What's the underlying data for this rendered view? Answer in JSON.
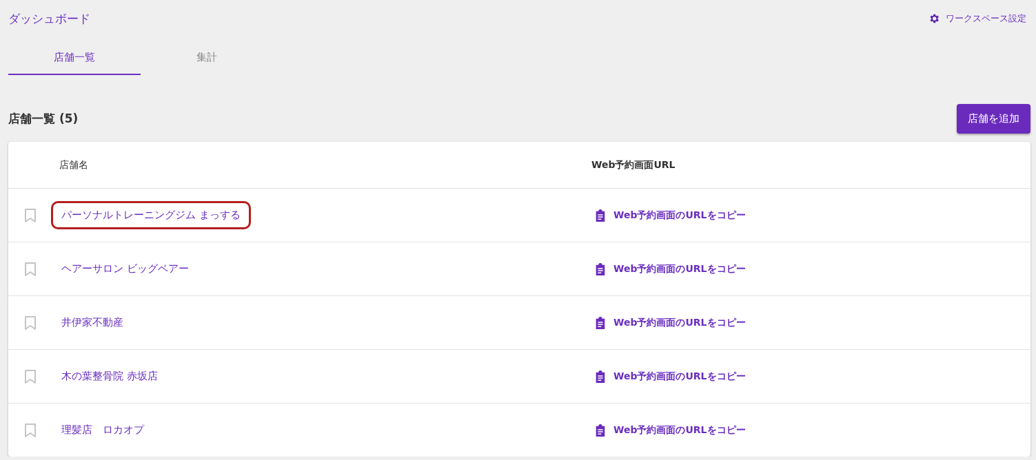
{
  "header": {
    "title": "ダッシュボード",
    "settings_link": "ワークスペース設定"
  },
  "tabs": [
    {
      "label": "店舗一覧",
      "selected": true
    },
    {
      "label": "集計",
      "selected": false
    }
  ],
  "section": {
    "title": "店舗一覧 (5)",
    "add_button": "店舗を追加"
  },
  "table": {
    "columns": [
      "店舗名",
      "Web予約画面URL"
    ],
    "rows": [
      {
        "name": "パーソナルトレーニングジム まっする",
        "bookmarked": false,
        "highlighted": true,
        "link": "Web予約画面のURLをコピー"
      },
      {
        "name": "ヘアーサロン ビッグベアー",
        "bookmarked": false,
        "highlighted": false,
        "link": "Web予約画面のURLをコピー"
      },
      {
        "name": "井伊家不動産",
        "bookmarked": false,
        "highlighted": false,
        "link": "Web予約画面のURLをコピー"
      },
      {
        "name": "木の葉整骨院 赤坂店",
        "bookmarked": false,
        "highlighted": false,
        "link": "Web予約画面のURLをコピー"
      },
      {
        "name": "理髪店　ロカオプ",
        "bookmarked": false,
        "highlighted": false,
        "link": "Web予約画面のURLをコピー"
      }
    ]
  }
}
